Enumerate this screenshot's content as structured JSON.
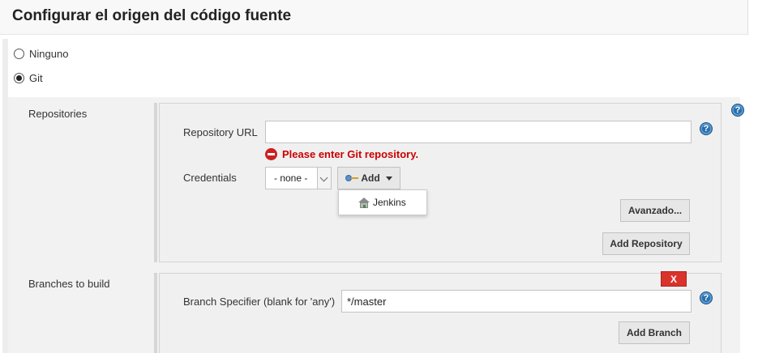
{
  "section": {
    "title": "Configurar el origen del código fuente"
  },
  "scm_options": [
    {
      "label": "Ninguno",
      "selected": false
    },
    {
      "label": "Git",
      "selected": true
    }
  ],
  "repositories": {
    "section_label": "Repositories",
    "url_label": "Repository URL",
    "url_value": "",
    "url_error": "Please enter Git repository.",
    "credentials_label": "Credentials",
    "credentials_selected": "- none -",
    "add_label": "Add",
    "add_menu_items": [
      "Jenkins"
    ],
    "advanced_label": "Avanzado...",
    "add_repository_label": "Add Repository"
  },
  "branches": {
    "section_label": "Branches to build",
    "delete_label": "X",
    "specifier_label": "Branch Specifier (blank for 'any')",
    "specifier_value": "*/master",
    "add_branch_label": "Add Branch"
  },
  "help": {
    "glyph": "?"
  },
  "colors": {
    "error_red": "#cc0000",
    "help_blue": "#2a6fad",
    "delete_red": "#d9332b",
    "panel_gray": "#f2f2f2"
  }
}
